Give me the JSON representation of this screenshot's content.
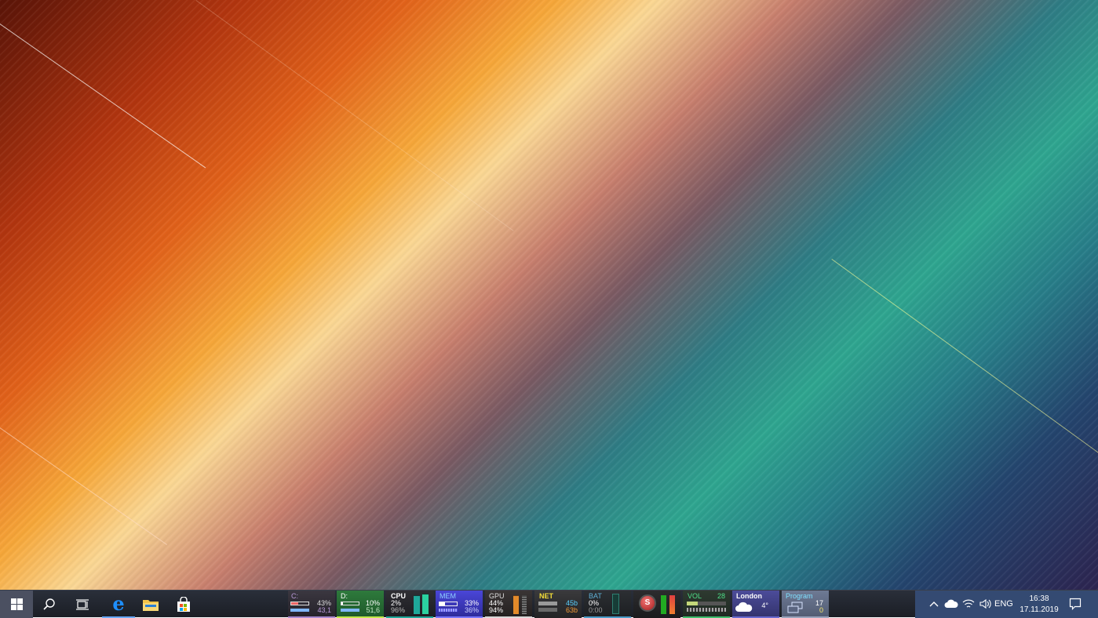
{
  "taskbar": {
    "start_label": "Start",
    "pinned": [
      {
        "name": "search-icon"
      },
      {
        "name": "task-view-icon"
      },
      {
        "name": "edge-icon"
      },
      {
        "name": "file-explorer-icon"
      },
      {
        "name": "store-icon"
      }
    ]
  },
  "widgets": {
    "drive_c": {
      "label": "C:",
      "used_pct": "43%",
      "value": "43,1",
      "fill": 0.43,
      "color": "#b89ad8"
    },
    "drive_d": {
      "label": "D:",
      "used_pct": "10%",
      "value": "51,6",
      "fill": 0.1,
      "color": "#3db53d"
    },
    "cpu": {
      "label": "CPU",
      "val1": "2%",
      "val2": "96%",
      "fill": 0.96,
      "color": "#1fa89a"
    },
    "mem": {
      "label": "MEM",
      "val1": "33%",
      "val2": "36%",
      "fill": 0.33,
      "color": "#4a46d8"
    },
    "gpu": {
      "label": "GPU",
      "val1": "44%",
      "val2": "94%",
      "fill": 0.94,
      "color": "#e38a2a"
    },
    "net": {
      "label": "NET",
      "down": "45b",
      "up": "63b",
      "color": "#f5df39"
    },
    "bat": {
      "label": "BAT",
      "val1": "0%",
      "val2": "0:00",
      "color": "#2f7f72"
    },
    "rec": {
      "letter": "S",
      "color": "#c93232"
    },
    "vol": {
      "label": "VOL",
      "value": "28",
      "fill": 0.28,
      "color": "#3fbf6e"
    },
    "weather": {
      "city": "London",
      "temp": "4°",
      "icon": "cloud-icon"
    },
    "program": {
      "label": "Program",
      "count1": "17",
      "count2": "0"
    }
  },
  "tray": {
    "lang": "ENG",
    "time": "16:38",
    "date": "17.11.2019",
    "accent": "#344a72"
  }
}
